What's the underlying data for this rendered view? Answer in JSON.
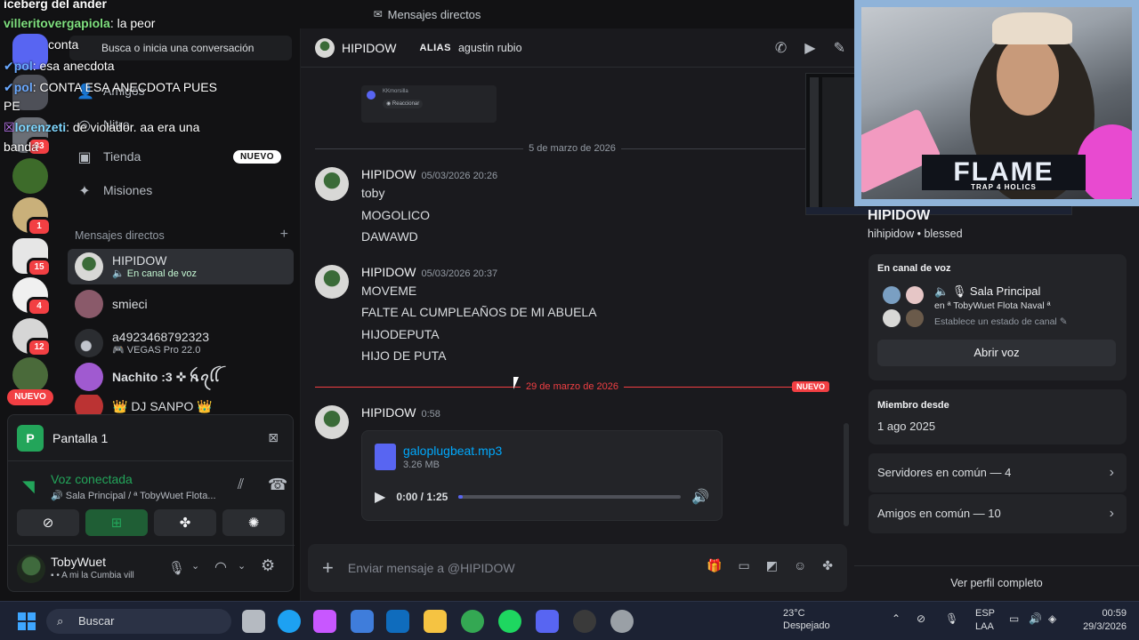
{
  "window": {
    "title": "Mensajes directos"
  },
  "search": {
    "placeholder": "Busca o inicia una conversación"
  },
  "nav": {
    "amigos": "Amigos",
    "nitro": "Nitro",
    "tienda": "Tienda",
    "tienda_badge": "NUEVO",
    "misiones": "Misiones"
  },
  "dm_section": {
    "title": "Mensajes directos",
    "add": "+"
  },
  "dms": [
    {
      "name": "HIPIDOW",
      "status": "En canal de voz"
    },
    {
      "name": "smieci",
      "status": ""
    },
    {
      "name": "a4923468792323",
      "status": "VEGAS Pro 22.0"
    },
    {
      "name": "Nachito :3 ✜ ꫝꪖꪶꪶ",
      "status": ""
    },
    {
      "name": "👑 DJ SANPO 👑",
      "status": ""
    }
  ],
  "servers": {
    "badges": [
      "33",
      "1",
      "15",
      "4",
      "12"
    ],
    "nuevo": "NUEVO"
  },
  "voice_panel": {
    "screen_icon": "P",
    "title": "Pantalla 1",
    "connected": "Voz conectada",
    "location": "Sala Principal / ª TobyWuet Flota..."
  },
  "user": {
    "name": "TobyWuet",
    "status": "A mi la Cumbia vill"
  },
  "chat": {
    "header_name": "HIPIDOW",
    "alias_label": "ALIAS",
    "alias_value": "agustin rubio",
    "date1": "5 de marzo de 2026",
    "date2": "29 de marzo de 2026",
    "new_tag": "NUEVO",
    "messages": [
      {
        "author": "HIPIDOW",
        "time": "05/03/2026 20:26",
        "lines": [
          "toby",
          "MOGOLICO",
          "DAWAWD"
        ]
      },
      {
        "author": "HIPIDOW",
        "time": "05/03/2026 20:37",
        "lines": [
          "MOVEME",
          "FALTE AL CUMPLEAÑOS DE MI ABUELA",
          "HIJODEPUTA",
          "HIJO DE PUTA"
        ]
      },
      {
        "author": "HIPIDOW",
        "time": "0:58",
        "lines": []
      }
    ],
    "preview_name": "KKmorsilla",
    "preview_action": "Reaccionar",
    "attachment": {
      "name": "galoplugbeat.mp3",
      "size": "3.26 MB",
      "time": "0:00 / 1:25",
      "progress": 0.02
    },
    "composer_placeholder": "Enviar mensaje a @HIPIDOW"
  },
  "profile": {
    "name": "HIPIDOW",
    "handle": "hihipidow • blessed",
    "voice_title": "En canal de voz",
    "channel": "Sala Principal",
    "channel_in": "en ª TobyWuet Flota Naval ª",
    "channel_status": "Establece un estado de canal",
    "join_button": "Abrir voz",
    "member_since_title": "Miembro desde",
    "member_since": "1 ago 2025",
    "servers_common": "Servidores en común — 4",
    "friends_common": "Amigos en común — 10",
    "full_profile": "Ver perfil completo"
  },
  "stream_overlay": {
    "logo": "FLAME",
    "logo_sub": "TRAP 4 HOLICS",
    "chat": [
      {
        "user": "",
        "text": "iceberg del ander"
      },
      {
        "user": "villeritovergapiola",
        "text": ": la peor"
      },
      {
        "user": "",
        "text": "conta"
      },
      {
        "user": "pol",
        "text": ": esa anecdota"
      },
      {
        "user": "pol",
        "text": ": CONTA ESA ANECDOTA PUES"
      },
      {
        "user": "",
        "text": "PE"
      },
      {
        "user": "lorenzeti",
        "text": ": de violador. aa era una"
      },
      {
        "user": "",
        "text": "banda"
      }
    ]
  },
  "taskbar": {
    "search": "Buscar",
    "temp": "23°C",
    "weather": "Despejado",
    "lang1": "ESP",
    "lang2": "LAA",
    "time": "00:59",
    "date": "29/3/2026"
  },
  "colors": {
    "accent": "#5865f2",
    "green": "#23a55a",
    "red": "#f23f43",
    "link": "#00a8fc"
  }
}
